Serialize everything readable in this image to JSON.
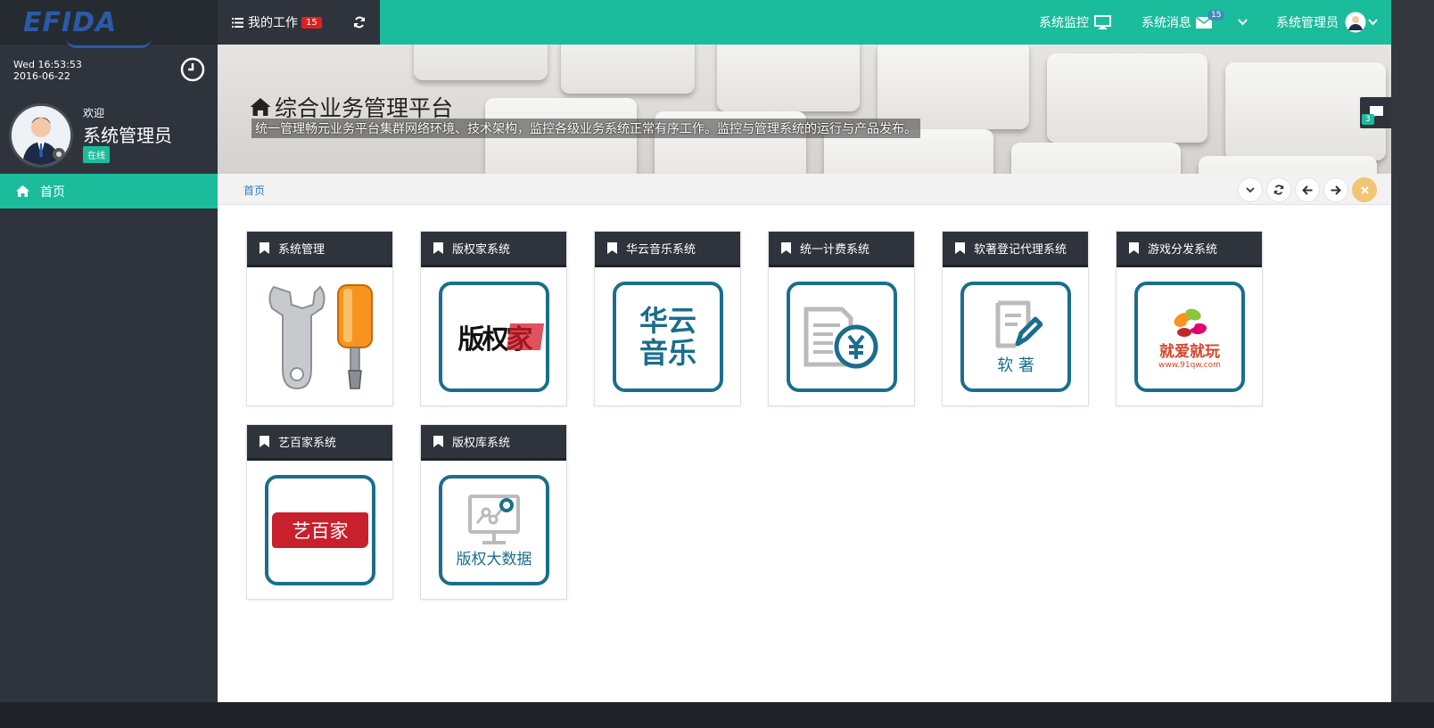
{
  "brand": {
    "logo_text": "EFIDA"
  },
  "sidebar": {
    "datetime_line1": "Wed 16:53:53",
    "datetime_line2": "2016-06-22",
    "welcome": "欢迎",
    "user_name": "系统管理员",
    "status": "在线",
    "nav": [
      {
        "label": "首页",
        "icon": "home-icon"
      }
    ]
  },
  "topbar": {
    "my_work_label": "我的工作",
    "my_work_count": "15",
    "monitor_label": "系统监控",
    "messages_label": "系统消息",
    "messages_count": "15",
    "user_label": "系统管理员"
  },
  "banner": {
    "title": "综合业务管理平台",
    "subtitle": "统一管理畅元业务平台集群网络环境、技术架构，监控各级业务系统正常有序工作。监控与管理系统的运行与产品发布。",
    "chat_count": "3"
  },
  "breadcrumb": {
    "home": "首页"
  },
  "colors": {
    "accent": "#1abc9c",
    "sidebar": "#2e333c",
    "tile_border": "#1a6e8c"
  },
  "systems": [
    {
      "title": "系统管理",
      "icon": "tools-icon"
    },
    {
      "title": "版权家系统",
      "icon": "banquanjia-logo",
      "logo_text": "版权家"
    },
    {
      "title": "华云音乐系统",
      "icon": "huayun-music-logo",
      "logo_text_1": "华云",
      "logo_text_2": "音乐"
    },
    {
      "title": "统一计费系统",
      "icon": "billing-icon"
    },
    {
      "title": "软著登记代理系统",
      "icon": "software-copyright-icon",
      "logo_text": "软 著"
    },
    {
      "title": "游戏分发系统",
      "icon": "game-logo",
      "logo_text": "就爱就玩",
      "logo_sub": "www.91qw.com"
    },
    {
      "title": "艺百家系统",
      "icon": "yibaijia-logo",
      "logo_text": "艺百家"
    },
    {
      "title": "版权库系统",
      "icon": "bigdata-icon",
      "logo_text": "版权大数据"
    }
  ]
}
